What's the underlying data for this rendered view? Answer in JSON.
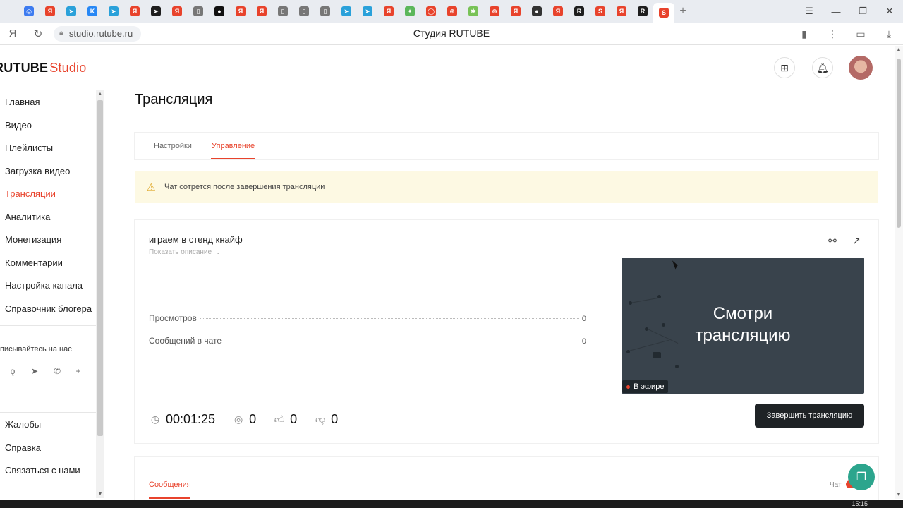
{
  "browser": {
    "tab_icons": [
      {
        "icon": "browser-icon",
        "color": "#3d7bf0"
      },
      {
        "icon": "yandex-icon",
        "color": "#e8432c"
      },
      {
        "icon": "telegram-icon",
        "color": "#2aa1da"
      },
      {
        "icon": "vk-icon",
        "color": "#2787f5"
      },
      {
        "icon": "telegram-icon",
        "color": "#2aa1da"
      },
      {
        "icon": "yandex-icon",
        "color": "#e8432c"
      },
      {
        "icon": "telegram-icon",
        "color": "#1e1e1e"
      },
      {
        "icon": "yandex-icon",
        "color": "#e8432c"
      },
      {
        "icon": "document-icon",
        "color": "#777777"
      },
      {
        "icon": "media-icon",
        "color": "#111111"
      },
      {
        "icon": "yandex-icon",
        "color": "#e8432c"
      },
      {
        "icon": "yandex-icon",
        "color": "#e8432c"
      },
      {
        "icon": "document-icon",
        "color": "#777777"
      },
      {
        "icon": "document-icon",
        "color": "#777777"
      },
      {
        "icon": "document-icon",
        "color": "#777777"
      },
      {
        "icon": "telegram-icon",
        "color": "#2aa1da"
      },
      {
        "icon": "telegram-icon",
        "color": "#2aa1da"
      },
      {
        "icon": "yandex-icon",
        "color": "#e8432c"
      },
      {
        "icon": "app-icon",
        "color": "#5bb75b"
      },
      {
        "icon": "circle-icon",
        "color": "#e8432c"
      },
      {
        "icon": "target-icon",
        "color": "#e8432c"
      },
      {
        "icon": "android-icon",
        "color": "#78c257"
      },
      {
        "icon": "target-icon",
        "color": "#e8432c"
      },
      {
        "icon": "yandex-icon",
        "color": "#e8432c"
      },
      {
        "icon": "media-icon",
        "color": "#333333"
      },
      {
        "icon": "yandex-icon",
        "color": "#e8432c"
      },
      {
        "icon": "rutube-icon",
        "color": "#1e1e1e"
      },
      {
        "icon": "studio-icon",
        "color": "#e8432c"
      },
      {
        "icon": "yandex-icon",
        "color": "#e8432c"
      },
      {
        "icon": "rutube-icon",
        "color": "#1e1e1e"
      },
      {
        "icon": "studio-icon",
        "color": "#e8432c"
      }
    ],
    "url": "studio.rutube.ru",
    "page_title": "Студия RUTUBE"
  },
  "header": {
    "logo_main": "RUTUBE",
    "logo_sub": "Studio"
  },
  "sidebar": {
    "items": [
      {
        "label": "Главная"
      },
      {
        "label": "Видео"
      },
      {
        "label": "Плейлисты"
      },
      {
        "label": "Загрузка видео"
      },
      {
        "label": "Трансляции",
        "active": true
      },
      {
        "label": "Аналитика"
      },
      {
        "label": "Монетизация"
      },
      {
        "label": "Комментарии"
      },
      {
        "label": "Настройка канала"
      },
      {
        "label": "Справочник блогера"
      }
    ],
    "follow_text": "писывайтесь на нас",
    "social_icons": [
      "odnoklassniki-icon",
      "telegram-icon",
      "viber-icon",
      "plus-icon"
    ],
    "bottom_items": [
      {
        "label": "Жалобы"
      },
      {
        "label": "Справка"
      },
      {
        "label": "Связаться с нами"
      }
    ]
  },
  "main": {
    "title": "Трансляция",
    "tabs": [
      {
        "label": "Настройки"
      },
      {
        "label": "Управление",
        "active": true
      }
    ],
    "warning": "Чат сотрется после завершения трансляции",
    "stream": {
      "name": "играем в стенд кнайф",
      "show_description": "Показать описание",
      "stats": [
        {
          "label": "Просмотров",
          "value": "0"
        },
        {
          "label": "Сообщений в чате",
          "value": "0"
        }
      ],
      "preview_text": "Смотри трансляцию",
      "live_label": "В эфире",
      "duration": "00:01:25",
      "viewers": "0",
      "likes": "0",
      "dislikes": "0",
      "end_button": "Завершить трансляцию"
    },
    "messages_tab": "Сообщения",
    "chat_label": "Чат"
  },
  "system": {
    "time": "15:15"
  },
  "colors": {
    "accent": "#e8432c",
    "warning_bg": "#fdf9e3",
    "preview_bg": "#39434c",
    "button_dark": "#1f2326",
    "fab": "#2ca58d"
  }
}
